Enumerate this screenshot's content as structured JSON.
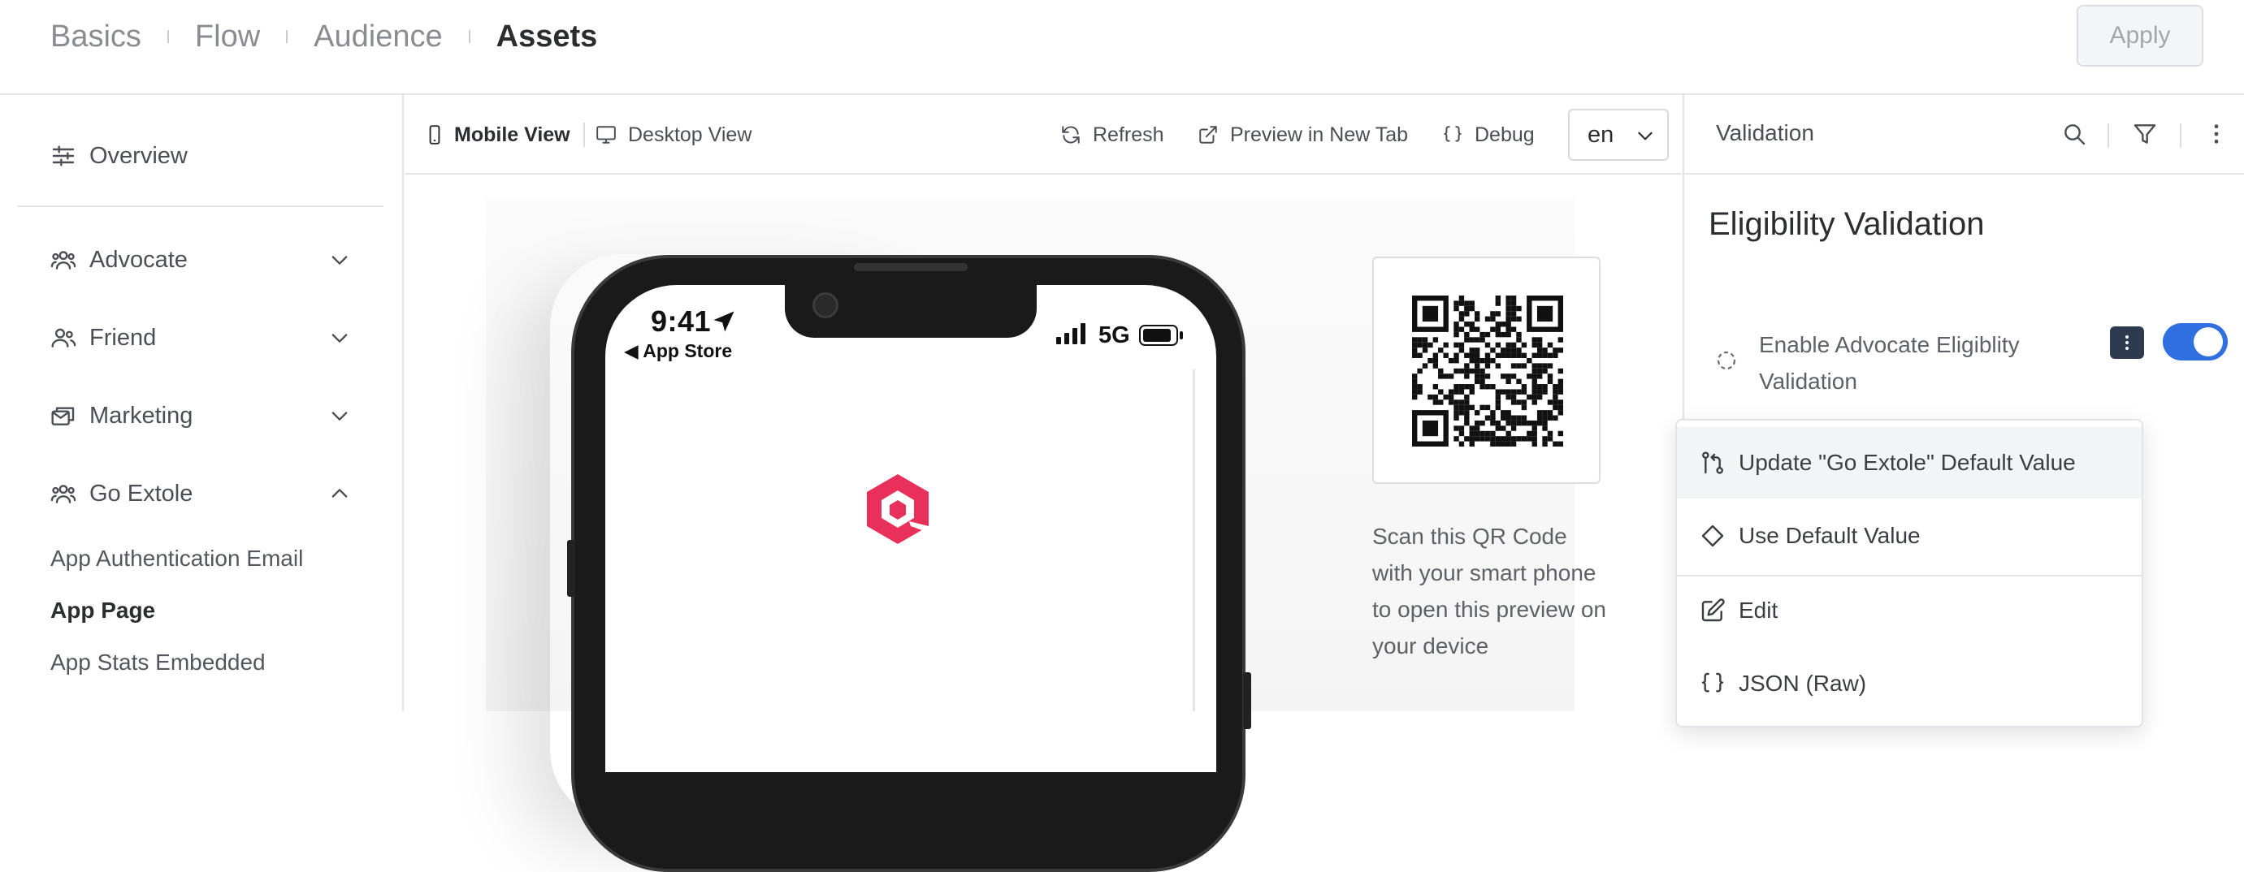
{
  "header": {
    "steps": [
      "Basics",
      "Flow",
      "Audience",
      "Assets"
    ],
    "active_step": "Assets",
    "apply_label": "Apply"
  },
  "sidebar": {
    "overview": "Overview",
    "groups": [
      {
        "label": "Advocate",
        "expanded": false,
        "icon": "users-icon"
      },
      {
        "label": "Friend",
        "expanded": false,
        "icon": "user-plus-icon"
      },
      {
        "label": "Marketing",
        "expanded": false,
        "icon": "mail-stack-icon"
      },
      {
        "label": "Go Extole",
        "expanded": true,
        "icon": "users-icon"
      }
    ],
    "sub_items": [
      "App Authentication Email",
      "App Page",
      "App Stats Embedded"
    ],
    "active_sub_item": "App Page"
  },
  "preview_toolbar": {
    "mobile_view": "Mobile View",
    "desktop_view": "Desktop View",
    "refresh": "Refresh",
    "preview_new_tab": "Preview in New Tab",
    "debug": "Debug",
    "language": "en"
  },
  "phone": {
    "time": "9:41",
    "back_label": "◀ App Store",
    "network": "5G"
  },
  "qr": {
    "caption": "Scan this QR Code with your smart phone to open this preview on your device"
  },
  "right_panel": {
    "title": "Validation",
    "section_title": "Eligibility Validation",
    "setting_label": "Enable Advocate Eligiblity Validation",
    "toggle_on": true
  },
  "context_menu": {
    "items": [
      {
        "label": "Update \"Go Extole\" Default Value",
        "icon": "git-compare-icon"
      },
      {
        "label": "Use Default Value",
        "icon": "diamond-icon"
      },
      {
        "label": "Edit",
        "icon": "edit-icon"
      },
      {
        "label": "JSON (Raw)",
        "icon": "braces-icon"
      }
    ]
  },
  "colors": {
    "toggle": "#2f6fe0",
    "brand_logo": "#e8305a",
    "kebab_bg": "#2e3a4f"
  }
}
